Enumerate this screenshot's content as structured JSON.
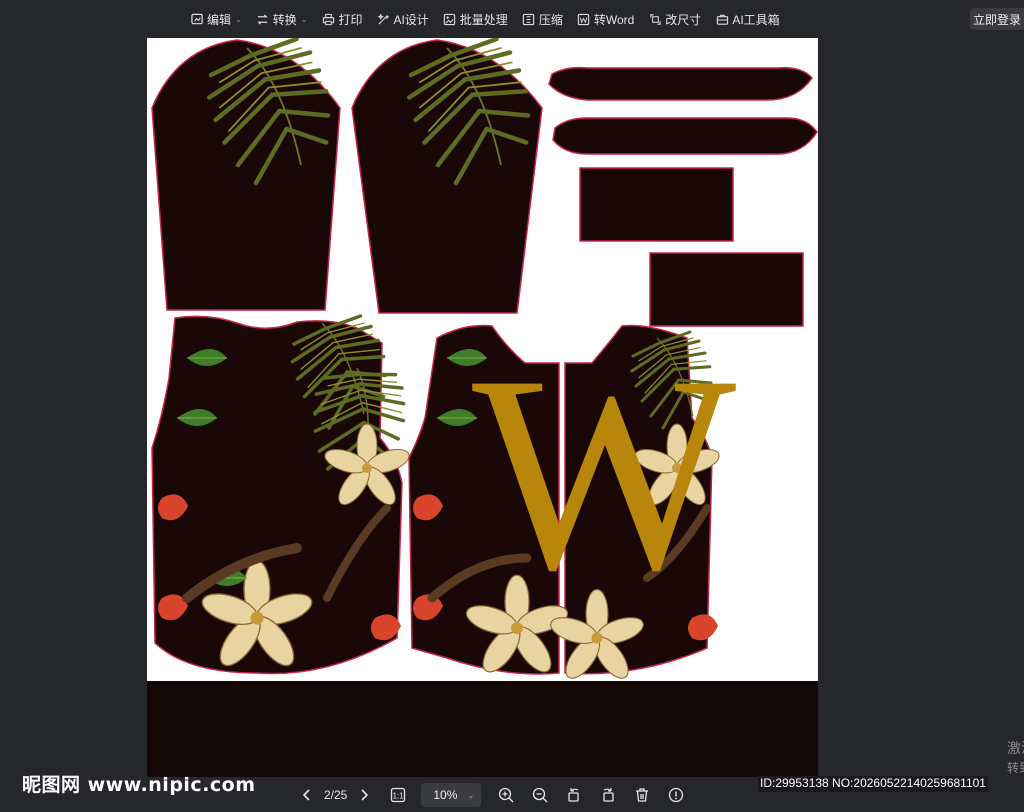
{
  "toolbar": {
    "items": [
      {
        "label": "编辑",
        "icon": "edit-icon",
        "caret": true
      },
      {
        "label": "转换",
        "icon": "convert-icon",
        "caret": true
      },
      {
        "label": "打印",
        "icon": "print-icon",
        "caret": false
      },
      {
        "label": "AI设计",
        "icon": "ai-design-icon",
        "caret": false
      },
      {
        "label": "批量处理",
        "icon": "batch-icon",
        "caret": false
      },
      {
        "label": "压缩",
        "icon": "compress-icon",
        "caret": false
      },
      {
        "label": "转Word",
        "icon": "word-icon",
        "caret": false
      },
      {
        "label": "改尺寸",
        "icon": "resize-icon",
        "caret": false
      },
      {
        "label": "AI工具箱",
        "icon": "ai-toolbox-icon",
        "caret": false
      }
    ],
    "login_label": "立即登录"
  },
  "watermark": {
    "logo_text": "昵图网 www.nipic.com"
  },
  "pager": {
    "page_text": "2/25",
    "zoom_value": "10%"
  },
  "image_id_text": "ID:29953138 NO:20260522140259681101",
  "side_text": {
    "line1": "激活",
    "line2": "转到"
  },
  "design": {
    "letter": "W",
    "colors": {
      "panel_dark": "#1a0809",
      "outline": "#c8244a",
      "letter_gold": "#b8860b",
      "palm_green": "#5e6b22",
      "flower_cream": "#e9d3a0",
      "flower_red": "#d9452c",
      "leaf_green": "#3f7d2a"
    }
  }
}
